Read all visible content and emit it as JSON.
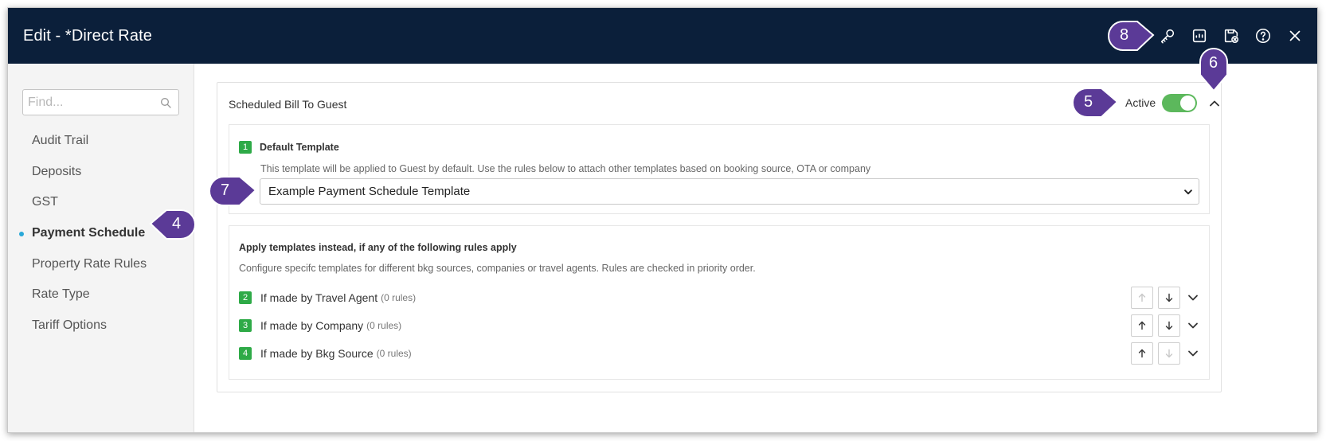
{
  "window": {
    "title": "Edit - *Direct Rate",
    "toolbar_icons": [
      "key-icon",
      "report-icon",
      "save-close-icon",
      "help-icon",
      "close-icon"
    ]
  },
  "sidebar": {
    "search_placeholder": "Find...",
    "items": [
      {
        "label": "Audit Trail",
        "active": false
      },
      {
        "label": "Deposits",
        "active": false
      },
      {
        "label": "GST",
        "active": false
      },
      {
        "label": "Payment Schedule",
        "active": true
      },
      {
        "label": "Property Rate Rules",
        "active": false
      },
      {
        "label": "Rate Type",
        "active": false
      },
      {
        "label": "Tariff Options",
        "active": false
      }
    ]
  },
  "section": {
    "title": "Scheduled Bill To Guest",
    "active_label": "Active",
    "active": true
  },
  "default_template": {
    "number": "1",
    "title": "Default Template",
    "description": "This template will be applied to Guest by default. Use the rules below to attach other templates based on booking source, OTA or company",
    "selected": "Example Payment Schedule Template"
  },
  "rules": {
    "title": "Apply templates instead, if any of the following rules apply",
    "description": "Configure specifc templates for different bkg sources, companies or travel agents. Rules are checked in priority order.",
    "items": [
      {
        "number": "2",
        "label": "If made by Travel Agent",
        "count": "(0 rules)",
        "up_enabled": false,
        "down_enabled": true
      },
      {
        "number": "3",
        "label": "If made by Company",
        "count": "(0 rules)",
        "up_enabled": true,
        "down_enabled": true
      },
      {
        "number": "4",
        "label": "If made by Bkg Source",
        "count": "(0 rules)",
        "up_enabled": true,
        "down_enabled": false
      }
    ]
  },
  "callouts": [
    {
      "number": "4"
    },
    {
      "number": "5"
    },
    {
      "number": "6"
    },
    {
      "number": "7"
    },
    {
      "number": "8"
    }
  ],
  "colors": {
    "titlebar": "#0b1f3a",
    "callout": "#5b3a97",
    "toggle_on": "#5cb85c",
    "step_badge": "#2eaa47",
    "active_dot": "#29a8d8"
  }
}
